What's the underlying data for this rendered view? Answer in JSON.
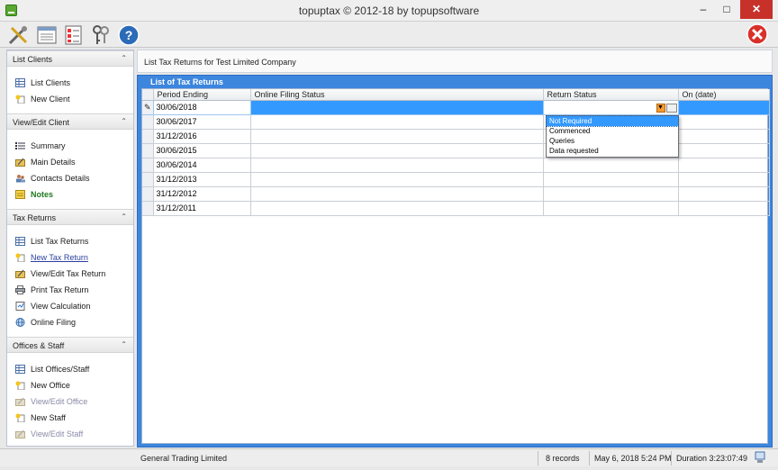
{
  "window": {
    "title": "topuptax © 2012-18 by topupsoftware",
    "minimize": "–",
    "maximize": "□",
    "close": "✕"
  },
  "toolbar": {
    "icons": [
      "tools-icon",
      "list-icon",
      "checklist-icon",
      "keys-icon",
      "help-icon",
      "exit-icon"
    ]
  },
  "sidebar": {
    "groups": [
      {
        "title": "List Clients",
        "items": [
          {
            "label": "List Clients",
            "icon": "grid-icon"
          },
          {
            "label": "New Client",
            "icon": "new-star-icon"
          }
        ]
      },
      {
        "title": "View/Edit Client",
        "items": [
          {
            "label": "Summary",
            "icon": "bullets-icon"
          },
          {
            "label": "Main Details",
            "icon": "folder-edit-icon"
          },
          {
            "label": "Contacts Details",
            "icon": "contacts-icon"
          },
          {
            "label": "Notes",
            "icon": "note-icon"
          }
        ]
      },
      {
        "title": "Tax Returns",
        "items": [
          {
            "label": "List Tax Returns",
            "icon": "grid-icon"
          },
          {
            "label": "New Tax Return",
            "icon": "new-star-icon"
          },
          {
            "label": "View/Edit Tax Return",
            "icon": "folder-edit-icon"
          },
          {
            "label": "Print Tax Return",
            "icon": "printer-icon"
          },
          {
            "label": "View Calculation",
            "icon": "calculation-icon"
          },
          {
            "label": "Online Filing",
            "icon": "globe-icon"
          }
        ]
      },
      {
        "title": "Offices & Staff",
        "items": [
          {
            "label": "List Offices/Staff",
            "icon": "grid-icon"
          },
          {
            "label": "New Office",
            "icon": "new-star-icon"
          },
          {
            "label": "View/Edit Office",
            "icon": "folder-edit-icon"
          },
          {
            "label": "New Staff",
            "icon": "new-star-icon"
          },
          {
            "label": "View/Edit Staff",
            "icon": "folder-edit-icon"
          }
        ]
      }
    ]
  },
  "main": {
    "breadcrumb": "List Tax Returns for Test Limited Company",
    "panel_title": "List of Tax Returns",
    "columns": [
      "Period Ending",
      "Online Filing Status",
      "Return Status",
      "On (date)"
    ],
    "rows": [
      {
        "period": "30/06/2018",
        "filing": "",
        "status": "",
        "on": ""
      },
      {
        "period": "30/06/2017",
        "filing": "",
        "status": "",
        "on": ""
      },
      {
        "period": "31/12/2016",
        "filing": "",
        "status": "",
        "on": ""
      },
      {
        "period": "30/06/2015",
        "filing": "",
        "status": "",
        "on": ""
      },
      {
        "period": "30/06/2014",
        "filing": "",
        "status": "",
        "on": ""
      },
      {
        "period": "31/12/2013",
        "filing": "",
        "status": "",
        "on": ""
      },
      {
        "period": "31/12/2012",
        "filing": "",
        "status": "",
        "on": ""
      },
      {
        "period": "31/12/2011",
        "filing": "",
        "status": "",
        "on": ""
      }
    ],
    "status_dropdown": {
      "options": [
        "Not Required",
        "Commenced",
        "Queries",
        "Data requested"
      ],
      "highlighted": "Not Required"
    }
  },
  "statusbar": {
    "company": "General Trading Limited",
    "records": "8 records",
    "datetime": "May 6, 2018 5:24 PM",
    "duration": "Duration 3:23:07:49"
  },
  "colors": {
    "panel_blue": "#3c86de",
    "selection": "#3399ff",
    "close_red": "#c7312a",
    "notes_green": "#1f7a1f"
  }
}
